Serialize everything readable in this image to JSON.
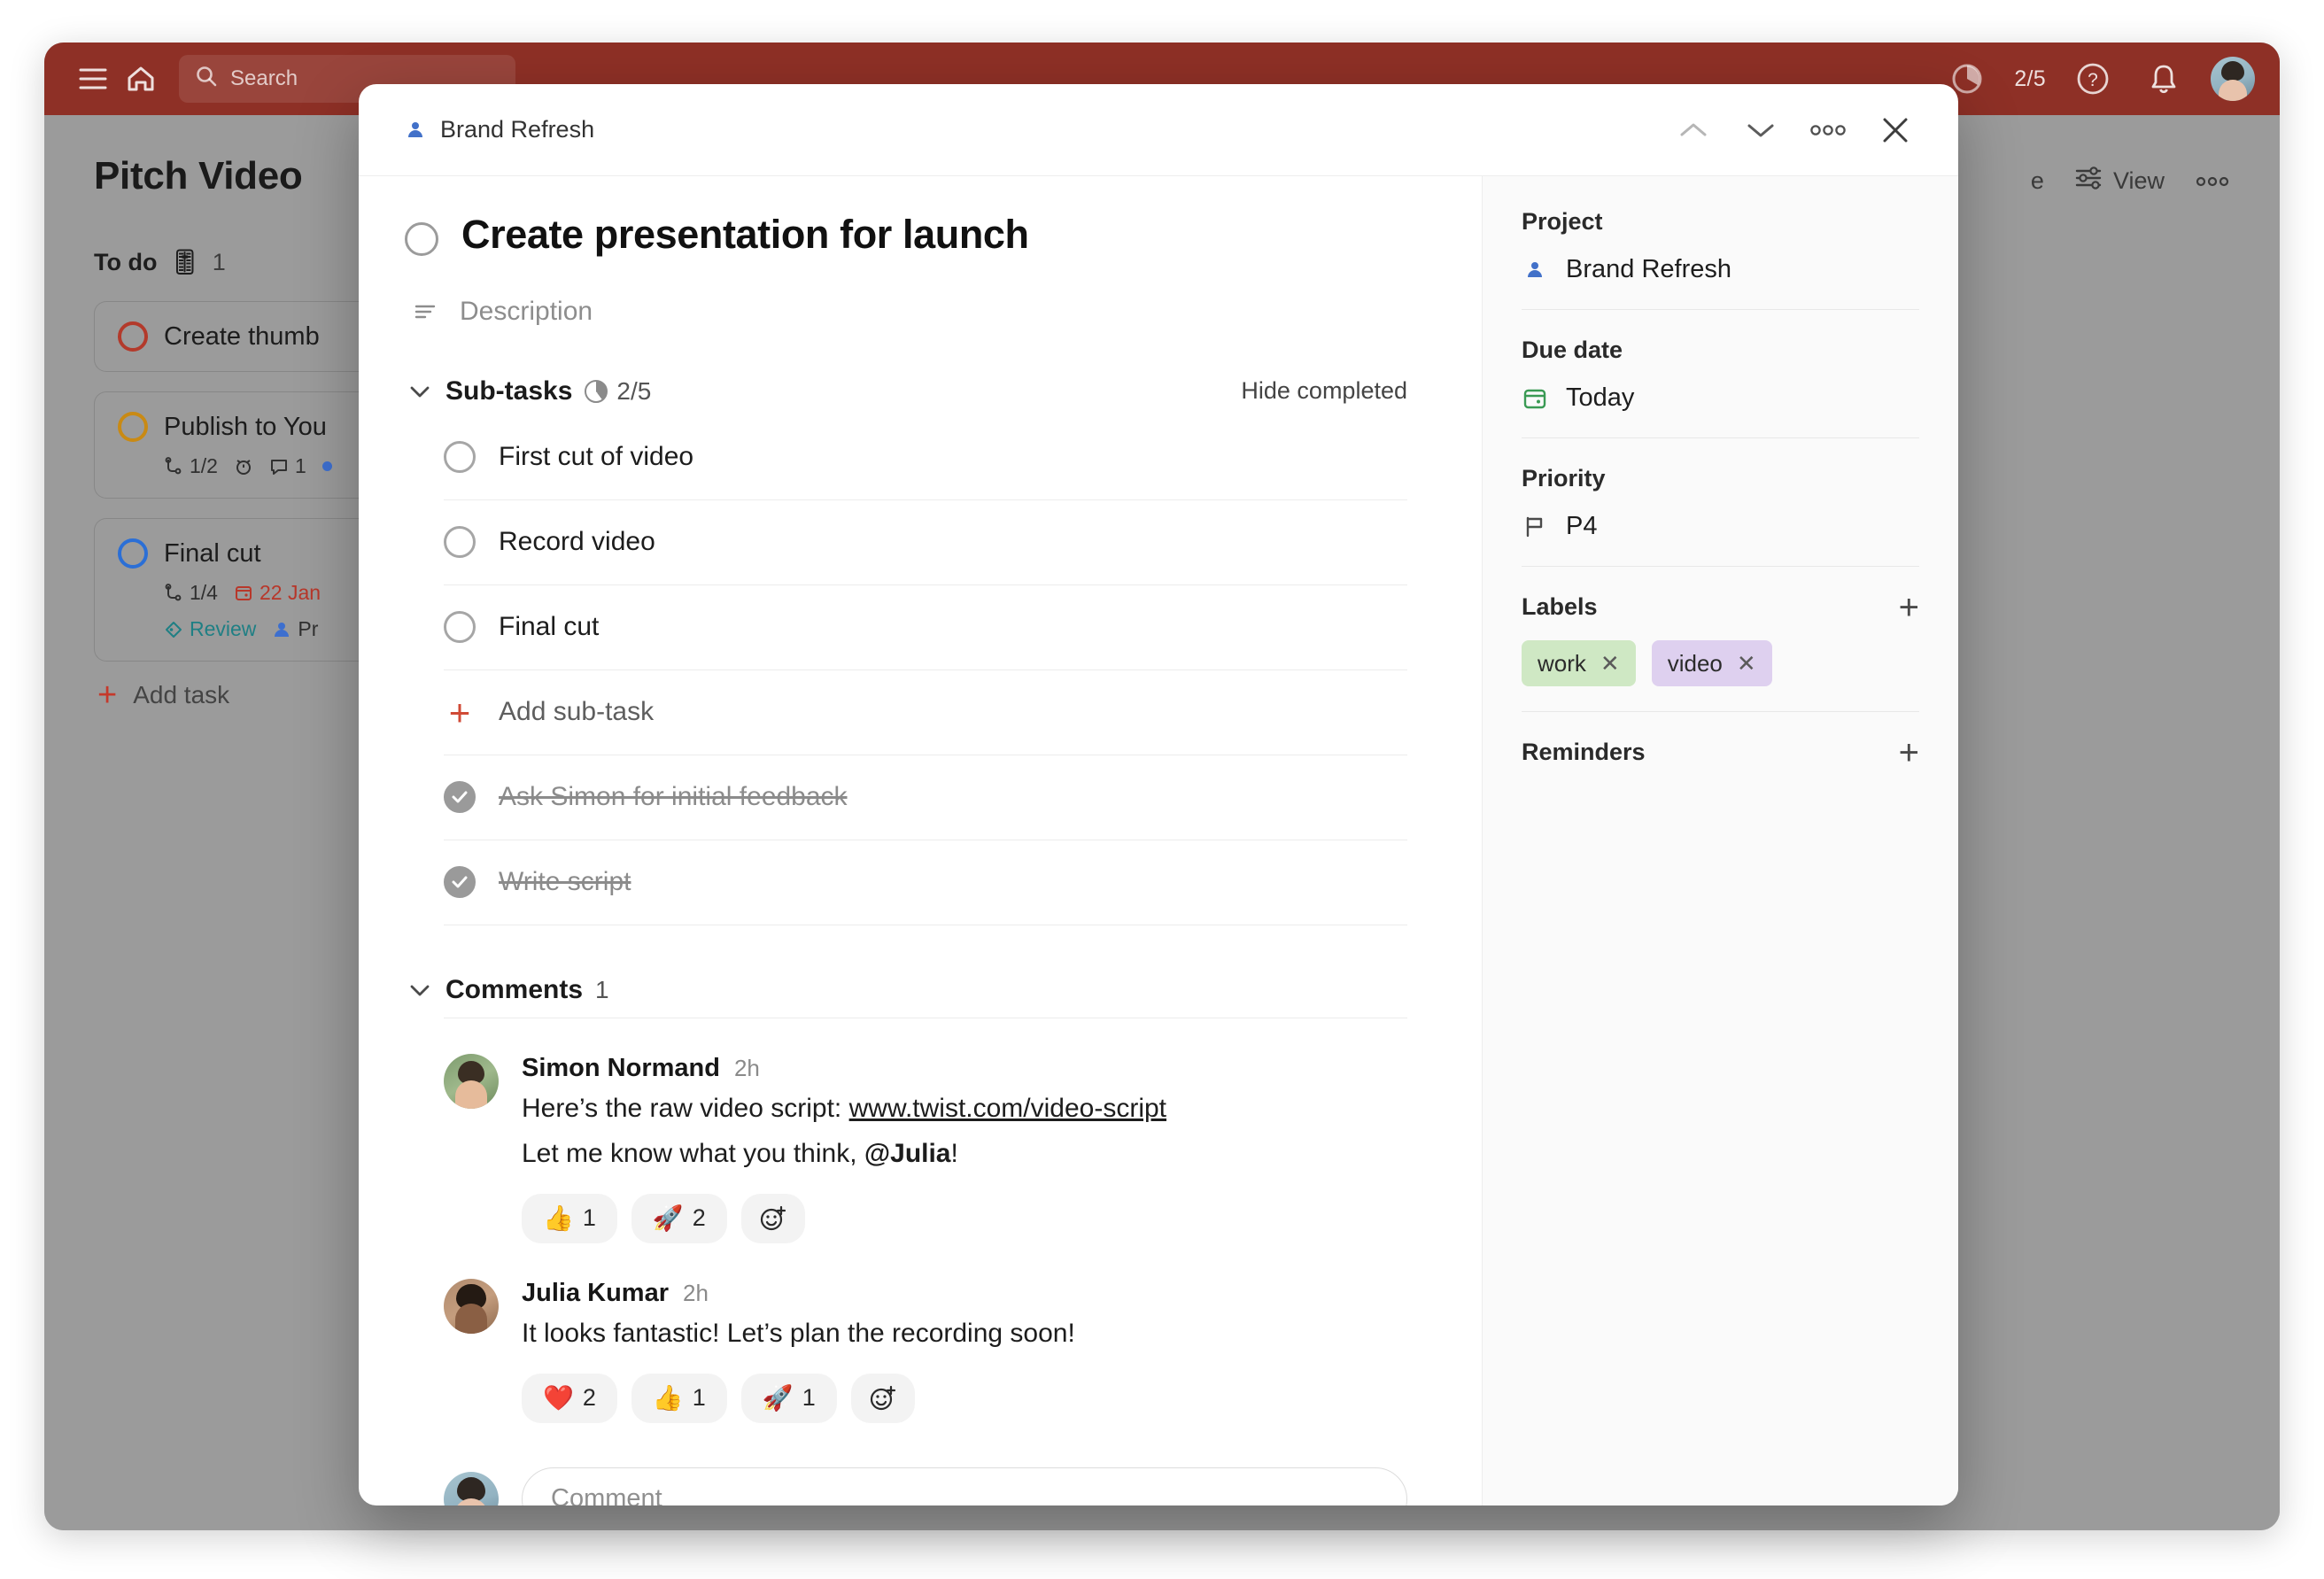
{
  "app": {
    "topbar": {
      "menu_icon": "hamburger-menu-icon",
      "home_icon": "home-icon",
      "search_icon": "search-icon",
      "search_placeholder": "Search",
      "progress_count": "2/5",
      "help_icon": "question-circle-icon",
      "bell_icon": "notification-bell-icon",
      "avatar": "user-avatar",
      "bg_color": "#8e3026"
    },
    "board": {
      "title": "Pitch Video",
      "view_label": "View",
      "more_label": "ooo",
      "column": {
        "name": "To do",
        "emoji": "🎚",
        "count": "1",
        "add_task_label": "Add task"
      },
      "cards": [
        {
          "title": "Create thumb",
          "circle_color": "#b33a2b",
          "meta": []
        },
        {
          "title": "Publish to You",
          "circle_color": "#c98a14",
          "meta": [
            {
              "icon": "subtask-icon",
              "text": "1/2"
            },
            {
              "icon": "alarm-icon",
              "text": ""
            },
            {
              "icon": "comment-icon",
              "text": "1"
            },
            {
              "icon": "dot-icon",
              "text": ""
            }
          ]
        },
        {
          "title": "Final cut",
          "circle_color": "#2b6fd6",
          "meta": [
            {
              "icon": "subtask-icon",
              "text": "1/4"
            },
            {
              "icon": "calendar-icon",
              "text": "22 Jan"
            }
          ],
          "meta2": [
            {
              "icon": "label-tag-icon",
              "text": "Review"
            },
            {
              "icon": "person-icon",
              "text": "Pr"
            }
          ]
        }
      ]
    }
  },
  "modal": {
    "breadcrumb": {
      "icon": "project-person-icon",
      "label": "Brand Refresh"
    },
    "header_actions": {
      "prev": "chevron-up-icon",
      "next": "chevron-down-icon",
      "more": "more-options-icon",
      "close": "close-icon"
    },
    "task": {
      "title": "Create presentation for launch",
      "completed": false,
      "description_placeholder": "Description"
    },
    "subtasks": {
      "title": "Sub-tasks",
      "progress": "2/5",
      "hide_completed_label": "Hide completed",
      "add_label": "Add sub-task",
      "items": [
        {
          "label": "First cut of video",
          "done": false
        },
        {
          "label": "Record video",
          "done": false
        },
        {
          "label": "Final cut",
          "done": false
        }
      ],
      "completed_items": [
        {
          "label": "Ask Simon for initial feedback",
          "done": true
        },
        {
          "label": "Write script",
          "done": true
        }
      ]
    },
    "comments": {
      "title": "Comments",
      "count": "1",
      "items": [
        {
          "author": "Simon Normand",
          "time": "2h",
          "avatar": "simon-avatar",
          "line1_prefix": "Here’s the raw video script: ",
          "link": "www.twist.com/video-script",
          "line2_prefix": "Let me know what you think, ",
          "mention": "@Julia",
          "line2_suffix": "!",
          "reactions": [
            {
              "emoji": "👍",
              "count": "1"
            },
            {
              "emoji": "🚀",
              "count": "2"
            }
          ],
          "add_reaction_icon": "add-reaction-icon"
        },
        {
          "author": "Julia Kumar",
          "time": "2h",
          "avatar": "julia-avatar",
          "text": "It looks fantastic! Let’s plan the recording soon!",
          "reactions": [
            {
              "emoji": "❤️",
              "count": "2"
            },
            {
              "emoji": "👍",
              "count": "1"
            },
            {
              "emoji": "🚀",
              "count": "1"
            }
          ],
          "add_reaction_icon": "add-reaction-icon"
        }
      ],
      "input_placeholder": "Comment",
      "input_avatar": "current-user-avatar"
    },
    "sidebar": {
      "project": {
        "label": "Project",
        "value": "Brand Refresh",
        "icon": "project-person-icon"
      },
      "due_date": {
        "label": "Due date",
        "value": "Today",
        "icon": "calendar-icon",
        "color": "#3a9a54"
      },
      "priority": {
        "label": "Priority",
        "value": "P4",
        "icon": "flag-icon"
      },
      "labels": {
        "label": "Labels",
        "add_icon": "plus-icon",
        "chips": [
          {
            "text": "work",
            "bg": "#cfe8c4"
          },
          {
            "text": "video",
            "bg": "#ded0ef"
          }
        ]
      },
      "reminders": {
        "label": "Reminders",
        "add_icon": "plus-icon"
      }
    }
  }
}
